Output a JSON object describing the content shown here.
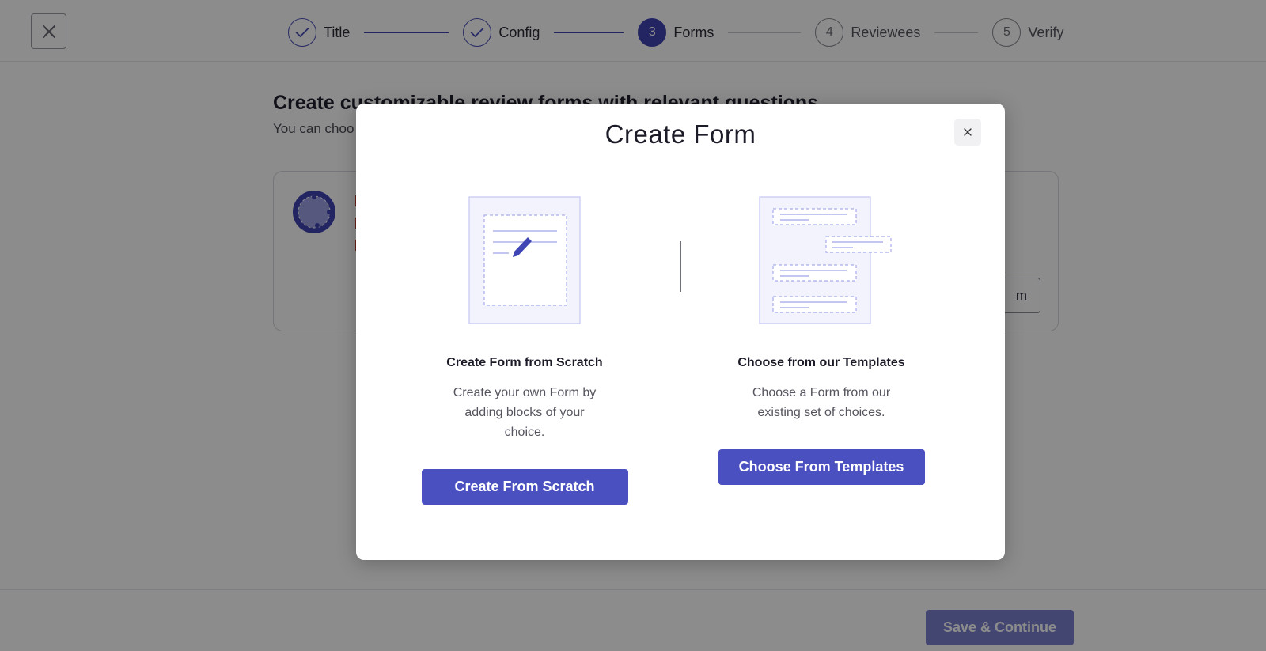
{
  "stepper": {
    "steps": [
      {
        "label": "Title",
        "number": "",
        "state": "done"
      },
      {
        "label": "Config",
        "number": "",
        "state": "done"
      },
      {
        "label": "Forms",
        "number": "3",
        "state": "active"
      },
      {
        "label": "Reviewees",
        "number": "4",
        "state": "pending"
      },
      {
        "label": "Verify",
        "number": "5",
        "state": "pending"
      }
    ]
  },
  "page": {
    "title": "Create customizable review forms with relevant questions",
    "subtitle": "You can choo",
    "card_button_label": "m"
  },
  "footer": {
    "save_label": "Save & Continue"
  },
  "modal": {
    "title": "Create Form",
    "close_label": "×",
    "options": [
      {
        "title": "Create Form from Scratch",
        "description": "Create your own Form by adding blocks of your choice.",
        "button_label": "Create From Scratch"
      },
      {
        "title": "Choose from our Templates",
        "description": "Choose a Form from our existing set of choices.",
        "button_label": "Choose From Templates"
      }
    ]
  },
  "colors": {
    "primary": "#4b50c1",
    "primary_disabled": "#7c80cf",
    "illustration_fill": "#f3f3fd",
    "illustration_stroke": "#b9bbf0"
  }
}
